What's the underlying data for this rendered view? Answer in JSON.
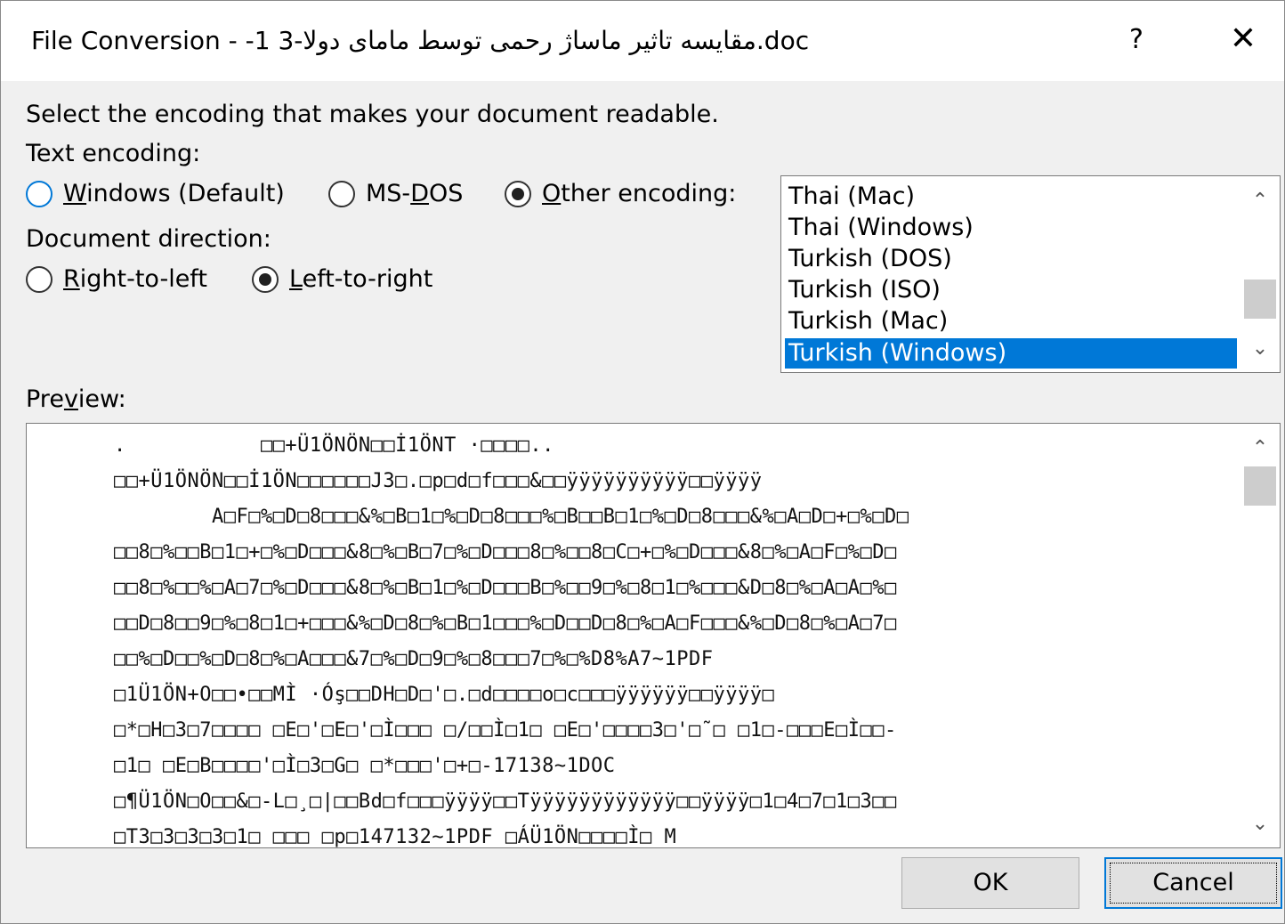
{
  "window": {
    "title": "File Conversion - -1 3-مقایسه تاثیر ماساژ رحمی توسط مامای دولا.doc",
    "help_glyph": "?",
    "close_glyph": "✕"
  },
  "instruction": "Select the encoding that makes your document readable.",
  "text_encoding": {
    "label": "Text encoding:",
    "options": [
      {
        "pre": "",
        "key": "W",
        "post": "indows (Default)",
        "checked": false
      },
      {
        "pre": "MS-",
        "key": "D",
        "post": "OS",
        "checked": false
      },
      {
        "pre": "",
        "key": "O",
        "post": "ther encoding:",
        "checked": true
      }
    ]
  },
  "direction": {
    "label": "Document direction:",
    "options": [
      {
        "pre": "",
        "key": "R",
        "post": "ight-to-left",
        "checked": false
      },
      {
        "pre": "",
        "key": "L",
        "post": "eft-to-right",
        "checked": true
      }
    ]
  },
  "encoding_list": {
    "items": [
      "Thai (Mac)",
      "Thai (Windows)",
      "Turkish (DOS)",
      "Turkish (ISO)",
      "Turkish (Mac)",
      "Turkish (Windows)"
    ],
    "selected": "Turkish (Windows)",
    "scroll_up": "⌃",
    "scroll_down": "⌄"
  },
  "preview": {
    "label_pre": "Pre",
    "label_key": "v",
    "label_post": "iew:",
    "lines": [
      ".           □□+Ü1ÖNÖN□□İ1ÖNT ·□□□□..",
      "□□+Ü1ÖNÖN□□İ1ÖN□□□□□□J3□.□p□d□f□□□&□□ÿÿÿÿÿÿÿÿÿÿ□□ÿÿÿÿ",
      "        A□F□%□D□8□□□&%□B□1□%□D□8□□□%□B□□B□1□%□D□8□□□&%□A□D□+□%□D□",
      "□□8□%□□B□1□+□%□D□□□&8□%□B□7□%□D□□□8□%□□8□C□+□%□D□□□&8□%□A□F□%□D□",
      "□□8□%□□%□A□7□%□D□□□&8□%□B□1□%□D□□□B□%□□9□%□8□1□%□□□&D□8□%□A□A□%□",
      "□□D□8□□9□%□8□1□+□□□&%□D□8□%□B□1□□□%□D□□D□8□%□A□F□□□&%□D□8□%□A□7□",
      "□□%□D□□%□D□8□%□A□□□&7□%□D□9□%□8□□□7□%□%D8%A7~1PDF",
      "□1Ü1ÖN+O□□•□□MÌ ·Óş□□DH□D□'□.□d□□□□o□c□□□ÿÿÿÿÿÿ□□ÿÿÿÿ□",
      "□*□H□3□7□□□□ □E□'□E□'□Ì□□□ □/□□Ì□1□ □E□'□□□□3□'□˜□ □1□-□□□E□Ì□□-",
      "□1□ □E□B□□□□'□Ì□3□G□ □*□□□'□+□-17138~1DOC",
      "□¶Ü1ÖN□O□□&□-L□¸□|□□Bd□f□□□ÿÿÿÿ□□Tÿÿÿÿÿÿÿÿÿÿÿÿ□□ÿÿÿÿ□1□4□7□1□3□□",
      "□T3□3□3□3□1□ □□□ □p□147132~1PDF □ÁÜ1ÖN□□□□Ì□ M"
    ],
    "scroll_up": "⌃",
    "scroll_down": "⌄"
  },
  "buttons": {
    "ok": "OK",
    "cancel": "Cancel"
  }
}
